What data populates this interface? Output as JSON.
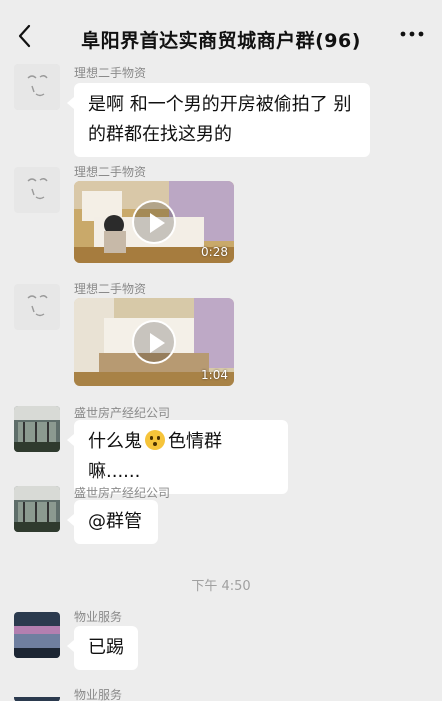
{
  "header": {
    "title": "阜阳界首达实商贸城商户群(96)",
    "back_icon": "chevron-left-icon",
    "more_icon": "more-dots-icon"
  },
  "messages": [
    {
      "sender": "理想二手物资",
      "type": "text",
      "lines": [
        "是啊 和一个男的开房被偷拍了 别",
        "的群都在找这男的"
      ]
    },
    {
      "sender": "理想二手物资",
      "type": "video",
      "duration": "0:28"
    },
    {
      "sender": "理想二手物资",
      "type": "video",
      "duration": "1:04"
    },
    {
      "sender": "盛世房产经纪公司",
      "type": "text",
      "text_before": "什么鬼",
      "emoji": "flushed-face-emoji",
      "text_after": "色情群嘛......"
    },
    {
      "sender": "盛世房产经纪公司",
      "type": "text",
      "text": "@群管"
    },
    {
      "sender": "物业服务",
      "type": "text",
      "text": "已踢"
    },
    {
      "sender": "物业服务",
      "type": "text",
      "text": ""
    }
  ],
  "timestamp": "下午 4:50",
  "colors": {
    "background": "#ededed",
    "bubble": "#ffffff",
    "meta_text": "#8a8a8a"
  }
}
